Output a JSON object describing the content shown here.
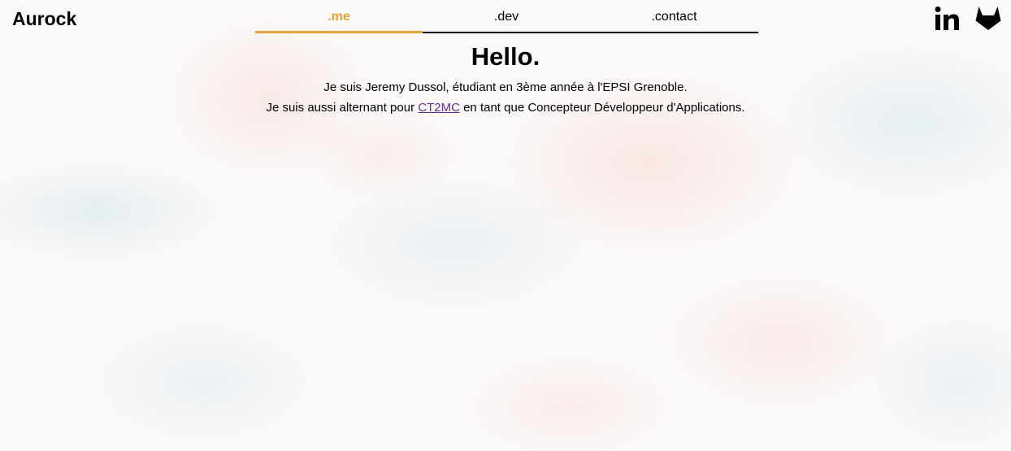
{
  "header": {
    "brand": "Aurock",
    "nav": [
      {
        "label": ".me",
        "active": true
      },
      {
        "label": ".dev",
        "active": false
      },
      {
        "label": ".contact",
        "active": false
      }
    ],
    "social": [
      {
        "icon": "linkedin-icon"
      },
      {
        "icon": "gitlab-icon"
      }
    ]
  },
  "main": {
    "title": "Hello.",
    "intro_line1": "Je suis Jeremy Dussol, étudiant en 3ème année à l'EPSI Grenoble.",
    "intro_line2_before": "Je suis aussi alternant pour ",
    "intro_link": "CT2MC",
    "intro_line2_after": " en tant que Concepteur Développeur d'Applications."
  },
  "colors": {
    "accent": "#e8a23a",
    "link": "#6a2d8f",
    "text": "#000000"
  }
}
